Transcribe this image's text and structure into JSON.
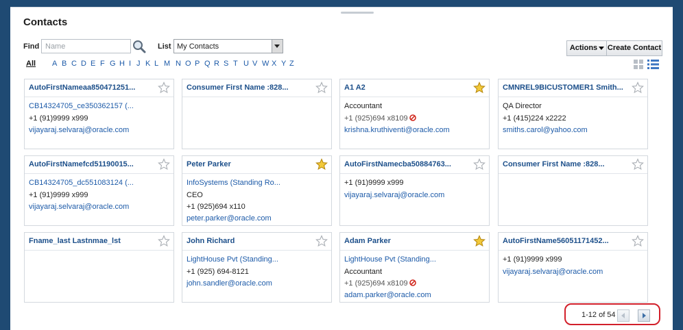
{
  "page": {
    "title": "Contacts"
  },
  "filter": {
    "find_label": "Find",
    "find_placeholder": "Name",
    "list_label": "List",
    "list_value": "My Contacts"
  },
  "toolbar": {
    "actions_label": "Actions",
    "create_label": "Create Contact"
  },
  "alphabet": [
    "All",
    "A",
    "B",
    "C",
    "D",
    "E",
    "F",
    "G",
    "H",
    "I",
    "J",
    "K",
    "L",
    "M",
    "N",
    "O",
    "P",
    "Q",
    "R",
    "S",
    "T",
    "U",
    "V",
    "W",
    "X",
    "Y",
    "Z"
  ],
  "contacts": [
    {
      "name": "AutoFirstNameaa850471251...",
      "starred": false,
      "lines": [
        {
          "text": "CB14324705_ce350362157 (...",
          "style": "link"
        },
        {
          "text": "+1 (91)9999 x999",
          "style": "txt"
        },
        {
          "text": "vijayaraj.selvaraj@oracle.com",
          "style": "link"
        }
      ]
    },
    {
      "name": "Consumer First Name :828...",
      "starred": false,
      "lines": []
    },
    {
      "name": "A1 A2",
      "starred": true,
      "lines": [
        {
          "text": "Accountant",
          "style": "txt"
        },
        {
          "text": "+1 (925)694 x8109",
          "style": "muted",
          "nocall": true
        },
        {
          "text": "krishna.kruthiventi@oracle.com",
          "style": "link"
        }
      ]
    },
    {
      "name": "CMNREL9BICUSTOMER1 Smith...",
      "starred": false,
      "lines": [
        {
          "text": "QA Director",
          "style": "txt"
        },
        {
          "text": "+1 (415)224 x2222",
          "style": "txt"
        },
        {
          "text": "smiths.carol@yahoo.com",
          "style": "link"
        }
      ]
    },
    {
      "name": "AutoFirstNamefcd51190015...",
      "starred": false,
      "lines": [
        {
          "text": "CB14324705_dc551083124 (...",
          "style": "link"
        },
        {
          "text": "+1 (91)9999 x999",
          "style": "txt"
        },
        {
          "text": "vijayaraj.selvaraj@oracle.com",
          "style": "link"
        }
      ]
    },
    {
      "name": "Peter Parker",
      "starred": true,
      "lines": [
        {
          "text": "InfoSystems (Standing Ro...",
          "style": "link"
        },
        {
          "text": "CEO",
          "style": "txt"
        },
        {
          "text": "+1 (925)694 x110",
          "style": "txt"
        },
        {
          "text": "peter.parker@oracle.com",
          "style": "link"
        }
      ]
    },
    {
      "name": "AutoFirstNamecba50884763...",
      "starred": false,
      "lines": [
        {
          "text": "+1 (91)9999 x999",
          "style": "txt"
        },
        {
          "text": "vijayaraj.selvaraj@oracle.com",
          "style": "link"
        }
      ]
    },
    {
      "name": "Consumer First Name :828...",
      "starred": false,
      "lines": []
    },
    {
      "name": "Fname_last Lastnmae_lst",
      "starred": false,
      "lines": []
    },
    {
      "name": "John Richard",
      "starred": false,
      "lines": [
        {
          "text": "LightHouse Pvt (Standing...",
          "style": "link"
        },
        {
          "text": "+1 (925) 694-8121",
          "style": "txt"
        },
        {
          "text": "john.sandler@oracle.com",
          "style": "link"
        }
      ]
    },
    {
      "name": "Adam Parker",
      "starred": true,
      "lines": [
        {
          "text": "LightHouse Pvt (Standing...",
          "style": "link"
        },
        {
          "text": "Accountant",
          "style": "txt"
        },
        {
          "text": "+1 (925)694 x8109",
          "style": "muted",
          "nocall": true
        },
        {
          "text": "adam.parker@oracle.com",
          "style": "link"
        }
      ]
    },
    {
      "name": "AutoFirstName56051171452...",
      "starred": false,
      "lines": [
        {
          "text": "+1 (91)9999 x999",
          "style": "txt"
        },
        {
          "text": "vijayaraj.selvaraj@oracle.com",
          "style": "link"
        }
      ]
    }
  ],
  "pagination": {
    "range_text": "1-12 of 54"
  },
  "colors": {
    "background": "#1f4a73",
    "link": "#1c5aa8",
    "star": "#f2c93a",
    "highlight_ring": "#d21f2a"
  }
}
